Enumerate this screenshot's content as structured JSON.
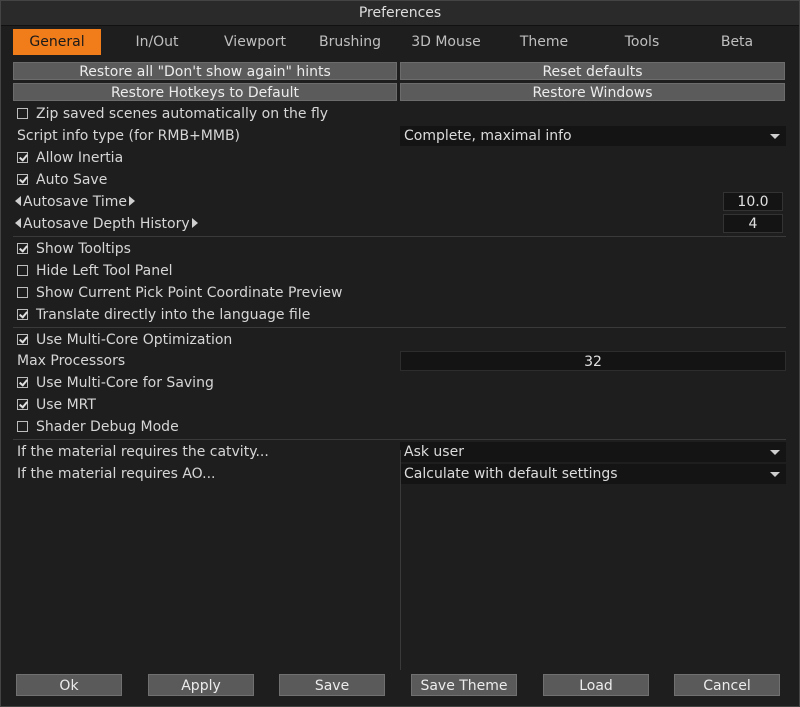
{
  "window": {
    "title": "Preferences"
  },
  "tabs": [
    {
      "label": "General",
      "active": true
    },
    {
      "label": "In/Out"
    },
    {
      "label": "Viewport"
    },
    {
      "label": "Brushing"
    },
    {
      "label": "3D Mouse"
    },
    {
      "label": "Theme"
    },
    {
      "label": "Tools"
    },
    {
      "label": "Beta"
    }
  ],
  "actions": {
    "restore_hints": "Restore all \"Don't show again\" hints",
    "reset_defaults": "Reset defaults",
    "restore_hotkeys": "Restore Hotkeys to Default",
    "restore_windows": "Restore Windows"
  },
  "general": {
    "zip_saved": {
      "label": "Zip saved scenes automatically on the fly",
      "checked": false
    },
    "script_info_label": "Script info type (for RMB+MMB)",
    "script_info_value": "Complete, maximal info",
    "allow_inertia": {
      "label": "Allow Inertia",
      "checked": true
    },
    "auto_save": {
      "label": "Auto Save",
      "checked": true
    },
    "autosave_time": {
      "label": "Autosave Time",
      "value": "10.0"
    },
    "autosave_depth": {
      "label": "Autosave Depth History",
      "value": "4"
    },
    "show_tooltips": {
      "label": "Show Tooltips",
      "checked": true
    },
    "hide_left_panel": {
      "label": "Hide Left Tool Panel",
      "checked": false
    },
    "show_pick_point": {
      "label": "Show Current Pick Point Coordinate Preview",
      "checked": false
    },
    "translate_lang": {
      "label": "Translate directly into the language file",
      "checked": true
    },
    "multi_core": {
      "label": "Use Multi-Core Optimization",
      "checked": true
    },
    "max_processors": {
      "label": "Max Processors",
      "value": "32"
    },
    "multi_core_saving": {
      "label": "Use Multi-Core for Saving",
      "checked": true
    },
    "use_mrt": {
      "label": "Use MRT",
      "checked": true
    },
    "shader_debug": {
      "label": "Shader Debug Mode",
      "checked": false
    },
    "cavity_label": "If the material requires the catvity...",
    "cavity_value": "Ask user",
    "ao_label": "If the material requires AO...",
    "ao_value": "Calculate with default settings"
  },
  "footer": {
    "ok": "Ok",
    "apply": "Apply",
    "save": "Save",
    "save_theme": "Save Theme",
    "load": "Load",
    "cancel": "Cancel"
  },
  "colors": {
    "accent": "#f07c1a",
    "background": "#1e1e1e",
    "button": "#5a5a5a"
  }
}
